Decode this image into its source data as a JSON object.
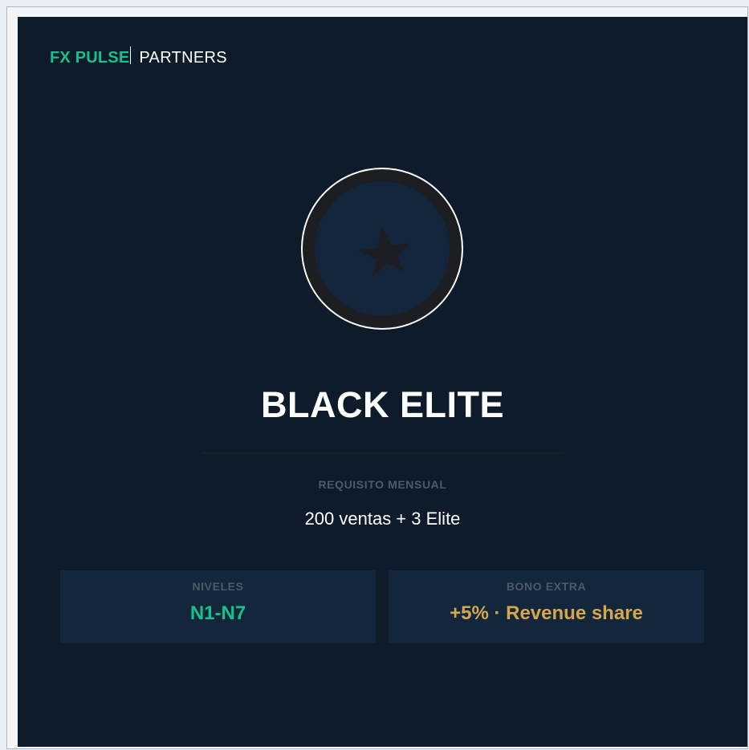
{
  "brand": {
    "name": "FX PULSE",
    "sub": "PARTNERS"
  },
  "tier": {
    "icon": "star-icon",
    "title": "BLACK ELITE"
  },
  "requirement": {
    "label": "REQUISITO MENSUAL",
    "value": "200 ventas + 3 Elite"
  },
  "stats": {
    "levels": {
      "label": "NIVELES",
      "value": "N1-N7"
    },
    "bonus": {
      "label": "BONO EXTRA",
      "value": "+5% · Revenue share"
    }
  },
  "colors": {
    "background": "#0d1b2a",
    "panel": "#14263b",
    "accent_green": "#17c28a",
    "accent_gold": "#d4a84a",
    "muted_label": "#4d5a68",
    "medal_ring": "#1d1e21"
  }
}
